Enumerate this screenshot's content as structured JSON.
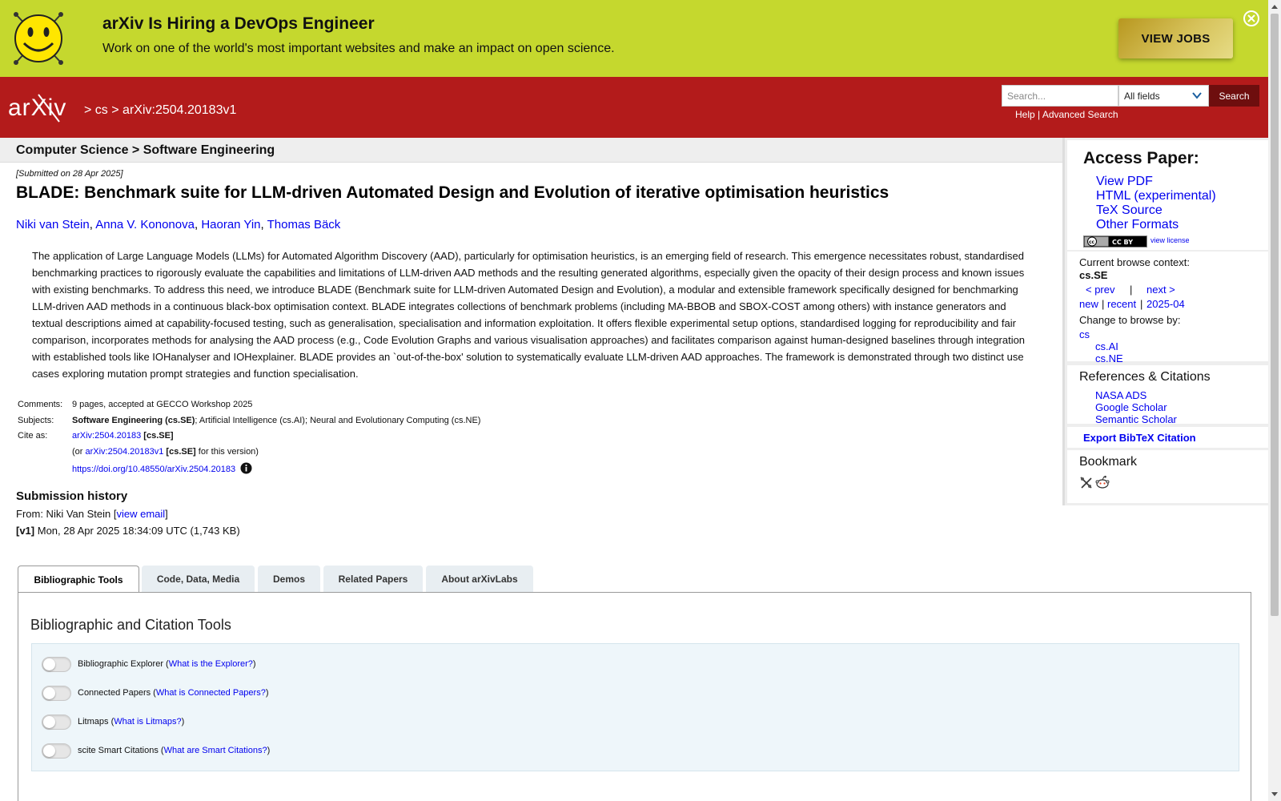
{
  "banner": {
    "title": "arXiv Is Hiring a DevOps Engineer",
    "subtitle": "Work on one of the world's most important websites and make an impact on open science.",
    "button": "VIEW JOBS",
    "logo_icon": "smiley-face-icon",
    "close_icon": "close-circle-icon",
    "bg_color": "#c5d82e"
  },
  "header": {
    "logo_text": "arXiv",
    "breadcrumb": [
      ">",
      "cs",
      ">",
      "arXiv:2504.20183v1"
    ],
    "search_placeholder": "Search...",
    "search_field": "All fields",
    "search_button": "Search",
    "help": "Help",
    "sep": "|",
    "advanced": "Advanced Search",
    "bg_color": "#b31b1b"
  },
  "subheader": "Computer Science > Software Engineering",
  "paper": {
    "submitted": "[Submitted on 28 Apr 2025]",
    "title": "BLADE: Benchmark suite for LLM-driven Automated Design and Evolution of iterative optimisation heuristics",
    "authors": [
      "Niki van Stein",
      "Anna V. Kononova",
      "Haoran Yin",
      "Thomas Bäck"
    ],
    "author_sep": ", ",
    "abstract": "The application of Large Language Models (LLMs) for Automated Algorithm Discovery (AAD), particularly for optimisation heuristics, is an emerging field of research. This emergence necessitates robust, standardised benchmarking practices to rigorously evaluate the capabilities and limitations of LLM-driven AAD methods and the resulting generated algorithms, especially given the opacity of their design process and known issues with existing benchmarks. To address this need, we introduce BLADE (Benchmark suite for LLM-driven Automated Design and Evolution), a modular and extensible framework specifically designed for benchmarking LLM-driven AAD methods in a continuous black-box optimisation context. BLADE integrates collections of benchmark problems (including MA-BBOB and SBOX-COST among others) with instance generators and textual descriptions aimed at capability-focused testing, such as generalisation, specialisation and information exploitation. It offers flexible experimental setup options, standardised logging for reproducibility and fair comparison, incorporates methods for analysing the AAD process (e.g., Code Evolution Graphs and various visualisation approaches) and facilitates comparison against human-designed baselines through integration with established tools like IOHanalyser and IOHexplainer. BLADE provides an `out-of-the-box' solution to systematically evaluate LLM-driven AAD approaches. The framework is demonstrated through two distinct use cases exploring mutation prompt strategies and function specialisation."
  },
  "meta": {
    "comments_label": "Comments:",
    "comments": "9 pages, accepted at GECCO Workshop 2025",
    "subjects_label": "Subjects:",
    "subjects_primary": "Software Engineering (cs.SE)",
    "subjects_rest": "; Artificial Intelligence (cs.AI); Neural and Evolutionary Computing (cs.NE)",
    "cite_label": "Cite as:",
    "cite_id": "arXiv:2504.20183",
    "cite_cat": "[cs.SE]",
    "or_prefix": "(or ",
    "cite_version": "arXiv:2504.20183v1",
    "or_suffix": " for this version)",
    "doi": "https://doi.org/10.48550/arXiv.2504.20183",
    "info_icon": "info-icon"
  },
  "history": {
    "title": "Submission history",
    "from_prefix": "From: Niki Van Stein [",
    "view_email": "view email",
    "from_suffix": "]",
    "v1_tag": "[v1]",
    "v1_text": " Mon, 28 Apr 2025 18:34:09 UTC (1,743 KB)"
  },
  "sidebar": {
    "access_title": "Access Paper:",
    "access_links": [
      "View PDF",
      "HTML (experimental)",
      "TeX Source",
      "Other Formats"
    ],
    "cc_badge": "CC BY",
    "view_license": "view license",
    "browse_context_label": "Current browse context:",
    "browse_context": "cs.SE",
    "prev": "< prev",
    "pipe": "|",
    "next": "next >",
    "new": "new",
    "recent": "recent",
    "month": "2025-04",
    "change_browse": "Change to browse by:",
    "browse_cs": "cs",
    "browse_ai": "cs.AI",
    "browse_ne": "cs.NE",
    "refs_title": "References & Citations",
    "refs": [
      "NASA ADS",
      "Google Scholar",
      "Semantic Scholar"
    ],
    "bibtex": "Export BibTeX Citation",
    "bookmark_title": "Bookmark",
    "bookmark_icons": [
      "bibsonomy-icon",
      "reddit-icon"
    ]
  },
  "tabs": [
    {
      "label": "Bibliographic Tools",
      "active": true
    },
    {
      "label": "Code, Data, Media",
      "active": false
    },
    {
      "label": "Demos",
      "active": false
    },
    {
      "label": "Related Papers",
      "active": false
    },
    {
      "label": "About arXivLabs",
      "active": false
    }
  ],
  "tools": {
    "title": "Bibliographic and Citation Tools",
    "items": [
      {
        "name": "Bibliographic Explorer",
        "help": "What is the Explorer?",
        "enabled": false
      },
      {
        "name": "Connected Papers",
        "help": "What is Connected Papers?",
        "enabled": false
      },
      {
        "name": "Litmaps",
        "help": "What is Litmaps?",
        "enabled": false
      },
      {
        "name": "scite Smart Citations",
        "help": "What are Smart Citations?",
        "enabled": false
      }
    ],
    "open_paren": " (",
    "close_paren": ")"
  }
}
